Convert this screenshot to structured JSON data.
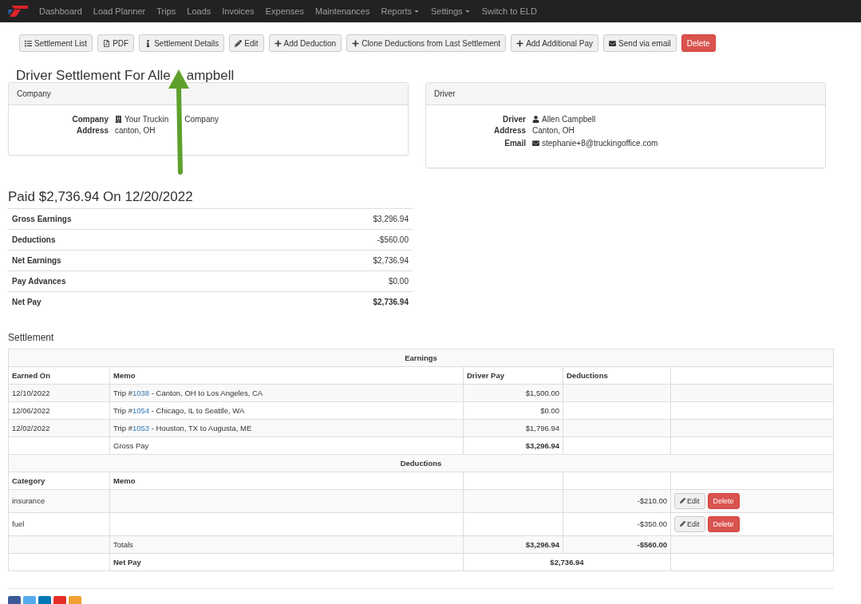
{
  "nav": {
    "items": [
      {
        "label": "Dashboard",
        "dropdown": false
      },
      {
        "label": "Load Planner",
        "dropdown": false
      },
      {
        "label": "Trips",
        "dropdown": false
      },
      {
        "label": "Loads",
        "dropdown": false
      },
      {
        "label": "Invoices",
        "dropdown": false
      },
      {
        "label": "Expenses",
        "dropdown": false
      },
      {
        "label": "Maintenances",
        "dropdown": false
      },
      {
        "label": "Reports",
        "dropdown": true
      },
      {
        "label": "Settings",
        "dropdown": true
      },
      {
        "label": "Switch to ELD",
        "dropdown": false
      }
    ]
  },
  "toolbar": [
    {
      "label": "Settlement List",
      "kind": "default"
    },
    {
      "label": "PDF",
      "kind": "default"
    },
    {
      "label": "Settlement Details",
      "kind": "default"
    },
    {
      "label": "Edit",
      "kind": "default"
    },
    {
      "label": "Add Deduction",
      "kind": "default"
    },
    {
      "label": "Clone Deductions from Last Settlement",
      "kind": "default"
    },
    {
      "label": "Add Additional Pay",
      "kind": "default"
    },
    {
      "label": "Send via email",
      "kind": "default"
    },
    {
      "label": "Delete",
      "kind": "danger"
    }
  ],
  "title": [
    "Driver Settlement For Alle",
    "ampbell"
  ],
  "panels": [
    {
      "heading": "Company",
      "fields": [
        {
          "label": "Company",
          "value": [
            "Your Truckin",
            "Company"
          ]
        },
        {
          "label": "Address",
          "value": [
            "canton, OH"
          ]
        }
      ]
    },
    {
      "heading": "Driver",
      "fields": [
        {
          "label": "Driver",
          "value": [
            "Allen Campbell"
          ]
        },
        {
          "label": "Address",
          "value": [
            "Canton, OH"
          ]
        },
        {
          "label": "Email",
          "value": [
            "stephanie+8@truckingoffice.com"
          ]
        }
      ]
    }
  ],
  "summary": {
    "title": "Paid $2,736.94 On 12/20/2022",
    "rows": [
      {
        "label": "Gross Earnings",
        "value": "$3,296.94"
      },
      {
        "label": "Deductions",
        "value": "-$560.00"
      },
      {
        "label": "Net Earnings",
        "value": "$2,736.94"
      },
      {
        "label": "Pay Advances",
        "value": "$0.00"
      },
      {
        "label": "Net Pay",
        "value": "$2,736.94"
      }
    ]
  },
  "settlement": {
    "title": "Settlement",
    "earnings": {
      "heading": "Earnings",
      "columns": [
        "Earned On",
        "Memo",
        "Driver Pay",
        "Deductions"
      ],
      "rows": [
        {
          "date": "12/10/2022",
          "prefix": "Trip #",
          "trip": "1038",
          "route": " - Canton, OH to Los Angeles, CA",
          "pay": "$1,500.00"
        },
        {
          "date": "12/06/2022",
          "prefix": "Trip #",
          "trip": "1054",
          "route": " - Chicago, IL to Seattle, WA",
          "pay": "$0.00"
        },
        {
          "date": "12/02/2022",
          "prefix": "Trip #",
          "trip": "1053",
          "route": " - Houston, TX to Augusta, ME",
          "pay": "$1,796.94"
        }
      ],
      "gross": {
        "label": "Gross Pay",
        "value": "$3,296.94"
      }
    },
    "deductions": {
      "heading": "Deductions",
      "columns": [
        "Category",
        "Memo"
      ],
      "rows": [
        {
          "category": "insurance",
          "amount": "-$210.00",
          "edit": "Edit",
          "delete": "Delete"
        },
        {
          "category": "fuel",
          "amount": "-$350.00",
          "edit": "Edit",
          "delete": "Delete"
        }
      ],
      "totals": {
        "label": "Totals",
        "pay": "$3,296.94",
        "deductions": "-$560.00"
      },
      "net": {
        "label": "Net Pay",
        "value": "$2,736.94"
      }
    }
  }
}
